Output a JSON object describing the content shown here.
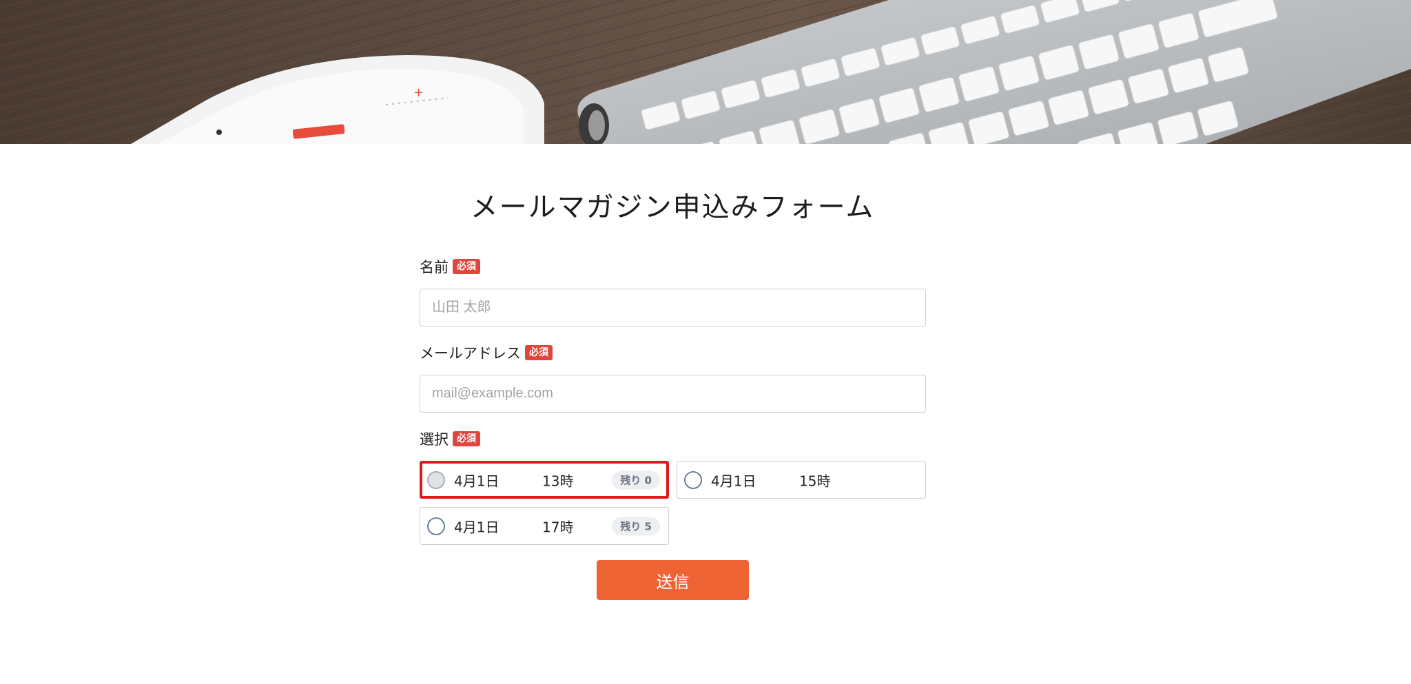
{
  "form": {
    "title": "メールマガジン申込みフォーム",
    "required_label": "必須",
    "fields": {
      "name": {
        "label": "名前",
        "placeholder": "山田 太郎",
        "value": ""
      },
      "email": {
        "label": "メールアドレス",
        "placeholder": "mail@example.com",
        "value": ""
      },
      "selection": {
        "label": "選択",
        "options": [
          {
            "date": "4月1日",
            "time": "13時",
            "remaining": "残り 0",
            "disabled": true
          },
          {
            "date": "4月1日",
            "time": "15時",
            "remaining": ""
          },
          {
            "date": "4月1日",
            "time": "17時",
            "remaining": "残り 5"
          }
        ]
      }
    },
    "submit_label": "送信"
  },
  "colors": {
    "accent_button": "#ee6334",
    "required_badge": "#e0463e",
    "highlight_outline": "#e01818"
  }
}
